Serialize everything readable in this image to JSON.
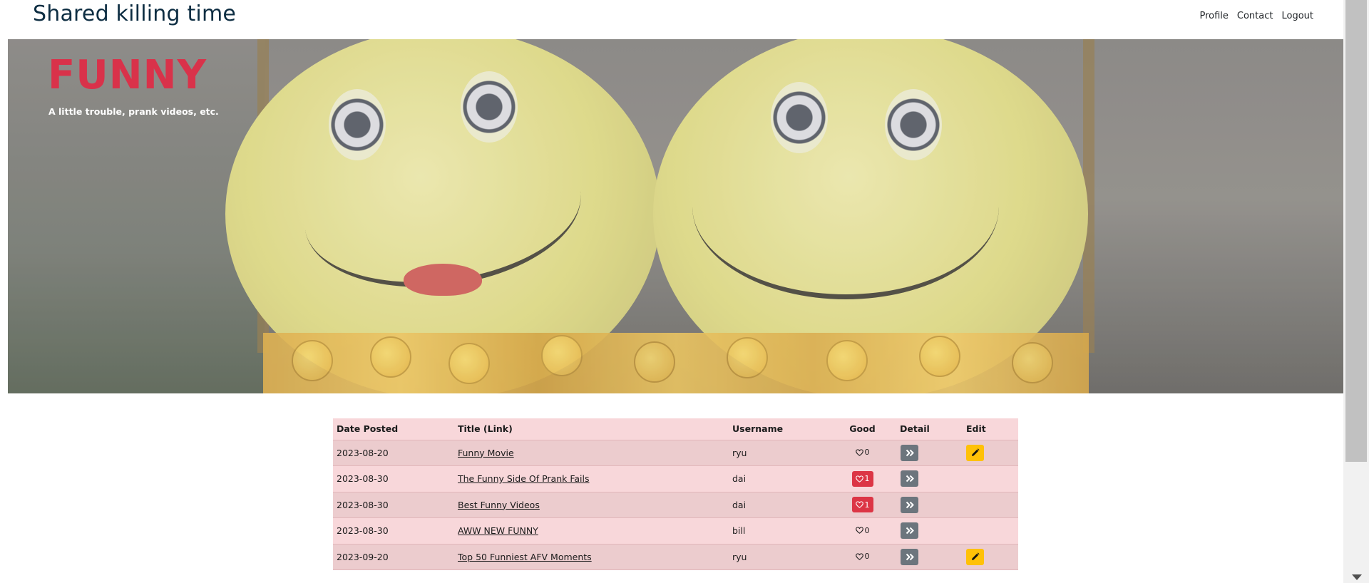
{
  "header": {
    "brand": "Shared killing time",
    "nav": [
      {
        "label": "Profile"
      },
      {
        "label": "Contact"
      },
      {
        "label": "Logout"
      }
    ]
  },
  "hero": {
    "title": "FUNNY",
    "subtitle": "A little trouble, prank videos, etc."
  },
  "table": {
    "headers": {
      "date": "Date Posted",
      "title": "Title (Link)",
      "username": "Username",
      "good": "Good",
      "detail": "Detail",
      "edit": "Edit"
    },
    "rows": [
      {
        "date": "2023-08-20",
        "title": "Funny Movie",
        "username": "ryu",
        "good": "0",
        "good_active": false,
        "editable": true
      },
      {
        "date": "2023-08-30",
        "title": "The Funny Side Of Prank Fails",
        "username": "dai",
        "good": "1",
        "good_active": true,
        "editable": false
      },
      {
        "date": "2023-08-30",
        "title": "Best Funny Videos",
        "username": "dai",
        "good": "1",
        "good_active": true,
        "editable": false
      },
      {
        "date": "2023-08-30",
        "title": "AWW NEW FUNNY",
        "username": "bill",
        "good": "0",
        "good_active": false,
        "editable": false
      },
      {
        "date": "2023-09-20",
        "title": "Top 50 Funniest AFV Moments",
        "username": "ryu",
        "good": "0",
        "good_active": false,
        "editable": true
      }
    ]
  },
  "colors": {
    "brand": "#0d2d42",
    "hero_title": "#d9324a",
    "table_bg": "#f8d7da",
    "good_active": "#dc3545",
    "detail_button": "#6c757d",
    "edit_button": "#ffc107"
  },
  "icons": {
    "good": "heart-icon",
    "detail": "double-chevron-right-icon",
    "edit": "pencil-icon"
  }
}
